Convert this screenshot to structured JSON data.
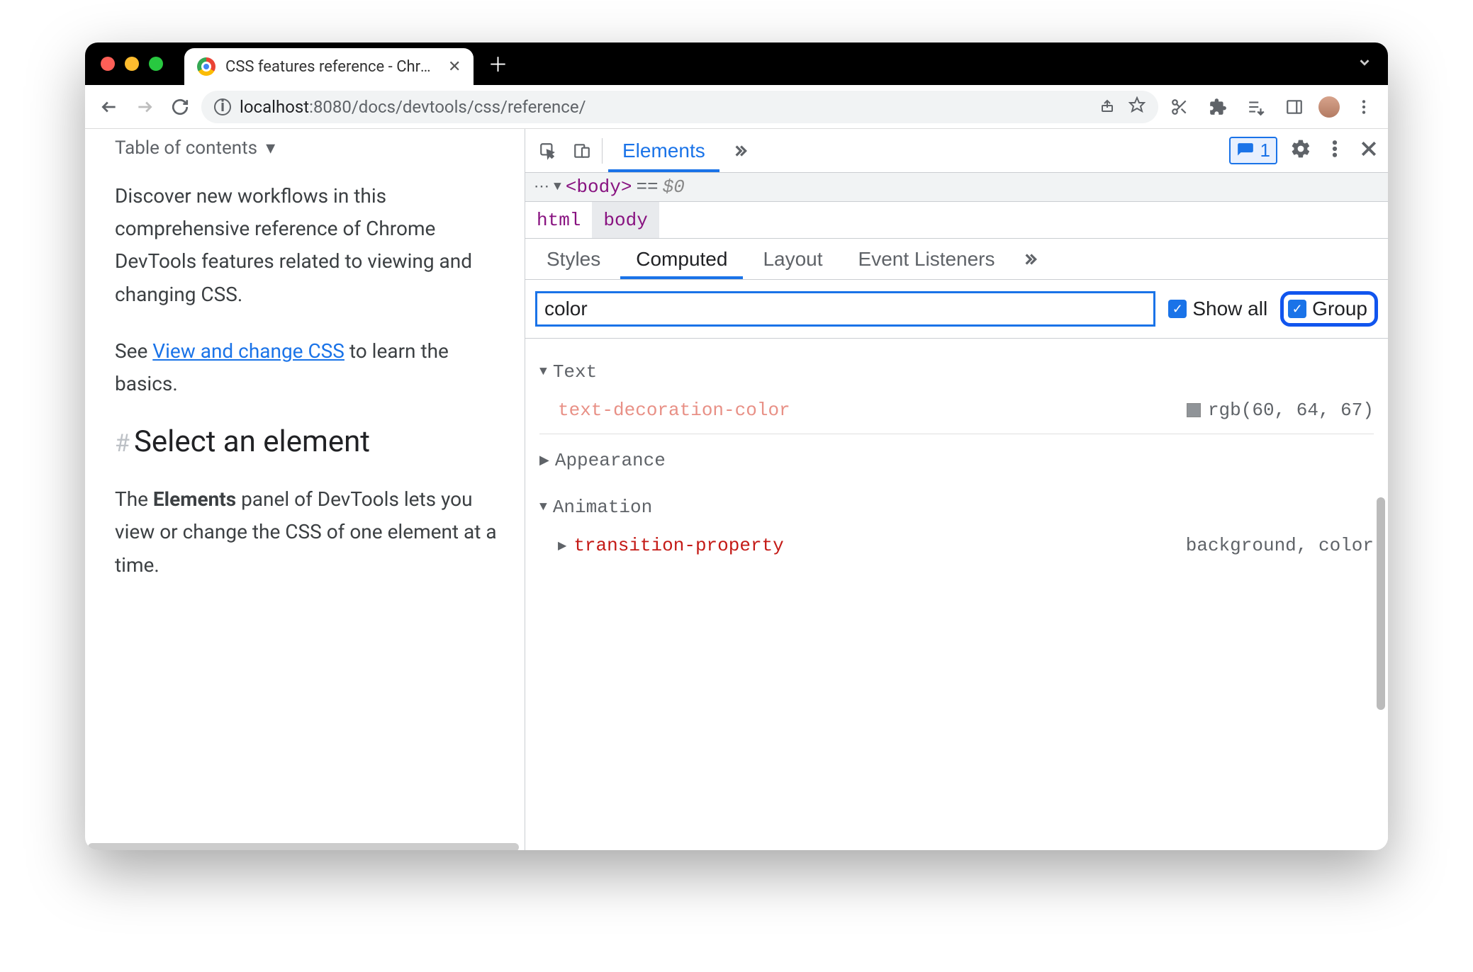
{
  "browser": {
    "tab_title": "CSS features reference - Chrom",
    "url_info_label": "i",
    "url_host": "localhost",
    "url_port": ":8080",
    "url_path": "/docs/devtools/css/reference/"
  },
  "page": {
    "toc_label": "Table of contents",
    "para1_a": "Discover new workflows in this comprehensive reference of Chrome DevTools features related to viewing and changing CSS.",
    "para2_prefix": "See ",
    "para2_link": "View and change CSS",
    "para2_suffix": " to learn the basics.",
    "h2": "Select an element",
    "para3_a": "The ",
    "para3_strong": "Elements",
    "para3_b": " panel of DevTools lets you view or change the CSS of one element at a time."
  },
  "devtools": {
    "main_tab": "Elements",
    "issues_count": "1",
    "dom_tag": "<body>",
    "dom_eq": "==",
    "dom_dollar": "$0",
    "breadcrumb": {
      "a": "html",
      "b": "body"
    },
    "tabs": {
      "styles": "Styles",
      "computed": "Computed",
      "layout": "Layout",
      "listeners": "Event Listeners"
    },
    "filter": {
      "value": "color",
      "show_all": "Show all",
      "group": "Group"
    },
    "groups": [
      {
        "name": "Text",
        "open": true,
        "props": [
          {
            "name": "text-decoration-color",
            "value": "rgb(60, 64, 67)",
            "swatch": true,
            "light": true
          }
        ]
      },
      {
        "name": "Appearance",
        "open": false,
        "props": []
      },
      {
        "name": "Animation",
        "open": true,
        "props": [
          {
            "name": "transition-property",
            "value": "background, color",
            "swatch": false,
            "light": false
          }
        ]
      }
    ]
  }
}
